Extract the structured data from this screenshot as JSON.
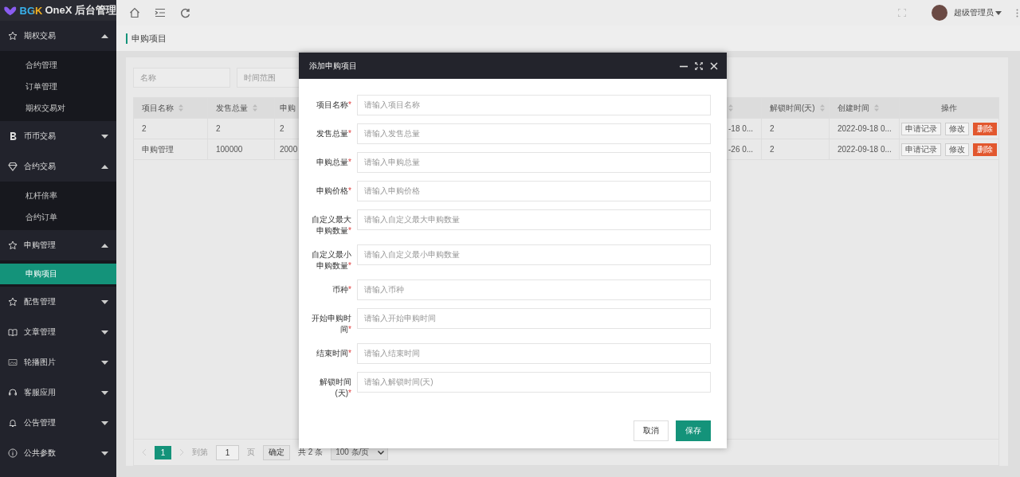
{
  "sidebar": {
    "logo": {
      "brand": "BGK",
      "title": "OneX 后台管理"
    },
    "groups": [
      {
        "label": "期权交易",
        "expanded": true,
        "children": [
          {
            "label": "合约管理",
            "selected": false
          },
          {
            "label": "订单管理",
            "selected": false
          },
          {
            "label": "期权交易对",
            "selected": false
          }
        ]
      },
      {
        "label": "币币交易",
        "expanded": false
      },
      {
        "label": "合约交易",
        "expanded": true,
        "children": [
          {
            "label": "杠杆倍率",
            "selected": false
          },
          {
            "label": "合约订单",
            "selected": false
          }
        ]
      },
      {
        "label": "申购管理",
        "expanded": true,
        "children": [
          {
            "label": "申购项目",
            "selected": true
          }
        ]
      },
      {
        "label": "配售管理",
        "expanded": false
      },
      {
        "label": "文章管理",
        "expanded": false
      },
      {
        "label": "轮播图片",
        "expanded": false
      },
      {
        "label": "客服应用",
        "expanded": false
      },
      {
        "label": "公告管理",
        "expanded": false
      },
      {
        "label": "公共参数",
        "expanded": false
      }
    ]
  },
  "header": {
    "user": {
      "name": "超级管理员"
    }
  },
  "page_tab": {
    "label": "申购项目",
    "selected": true
  },
  "filters": [
    {
      "placeholder": "名称"
    },
    {
      "placeholder": "时间范围"
    }
  ],
  "table": {
    "columns": [
      {
        "label": "项目名称",
        "sortable": true
      },
      {
        "label": "发售总量",
        "sortable": true
      },
      {
        "label": "申购"
      },
      {
        "sortable": true
      },
      {
        "label": "解锁时间(天)",
        "sortable": true
      },
      {
        "label": "创建时间",
        "sortable": true
      },
      {
        "label": "操作",
        "sortable": false
      }
    ],
    "rows": [
      {
        "cells": [
          "2",
          "2",
          "2",
          "-18 0...",
          "2",
          "2022-09-18 0..."
        ],
        "actions": [
          {
            "label": "申请记录",
            "kind": "default"
          },
          {
            "label": "修改",
            "kind": "default"
          },
          {
            "label": "删除",
            "kind": "danger"
          }
        ]
      },
      {
        "cells": [
          "申购管理",
          "100000",
          "2000",
          "-26 0...",
          "2",
          "2022-09-18 0..."
        ],
        "actions": [
          {
            "label": "申请记录",
            "kind": "default"
          },
          {
            "label": "修改",
            "kind": "default"
          },
          {
            "label": "删除",
            "kind": "danger"
          }
        ]
      }
    ]
  },
  "pagination": {
    "pages": [
      {
        "label": "1",
        "selected": true
      }
    ],
    "goto_label": "到第",
    "goto_value": "1",
    "page_unit": "页",
    "confirm": "确定",
    "total": "共 2 条",
    "page_size": "100 条/页"
  },
  "modal": {
    "title": "添加申购项目",
    "required_mark": "*",
    "fields": [
      {
        "label": "项目名称",
        "required": true,
        "placeholder": "请输入项目名称"
      },
      {
        "label": "发售总量",
        "required": true,
        "placeholder": "请输入发售总量"
      },
      {
        "label": "申购总量",
        "required": true,
        "placeholder": "请输入申购总量"
      },
      {
        "label": "申购价格",
        "required": true,
        "placeholder": "请输入申购价格"
      },
      {
        "label": "自定义最大申购数量",
        "required": true,
        "placeholder": "请输入自定义最大申购数量"
      },
      {
        "label": "自定义最小申购数量",
        "required": true,
        "placeholder": "请输入自定义最小申购数量"
      },
      {
        "label": "币种",
        "required": true,
        "placeholder": "请输入币种"
      },
      {
        "label": "开始申购时间",
        "required": true,
        "placeholder": "请输入开始申购时间"
      },
      {
        "label": "结束时间",
        "required": true,
        "placeholder": "请输入结束时间"
      },
      {
        "label": "解锁时间(天)",
        "required": true,
        "placeholder": "请输入解锁时间(天)"
      }
    ],
    "buttons": [
      {
        "label": "取消",
        "kind": "default"
      },
      {
        "label": "保存",
        "kind": "primary"
      }
    ]
  }
}
